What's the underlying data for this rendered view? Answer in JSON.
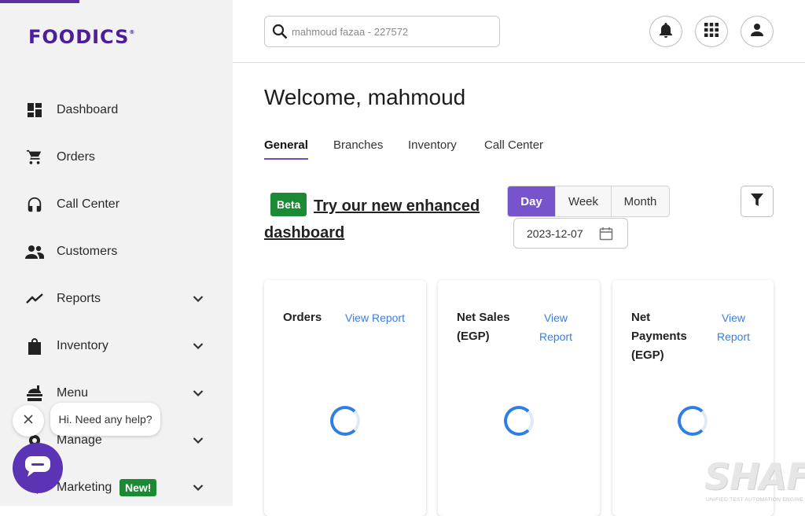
{
  "brand": {
    "logo_text": "FOODICS",
    "logo_mark": "®",
    "accent_color": "#5b33b5"
  },
  "sidebar": {
    "items": [
      {
        "label": "Dashboard",
        "icon": "dashboard-icon",
        "has_chevron": false
      },
      {
        "label": "Orders",
        "icon": "cart-icon",
        "has_chevron": false
      },
      {
        "label": "Call Center",
        "icon": "headset-icon",
        "has_chevron": false
      },
      {
        "label": "Customers",
        "icon": "people-icon",
        "has_chevron": false
      },
      {
        "label": "Reports",
        "icon": "trending-icon",
        "has_chevron": true
      },
      {
        "label": "Inventory",
        "icon": "bag-icon",
        "has_chevron": true
      },
      {
        "label": "Menu",
        "icon": "menu-food-icon",
        "has_chevron": true
      },
      {
        "label": "Manage",
        "icon": "gear-icon",
        "has_chevron": true
      },
      {
        "label": "Marketing",
        "icon": "megaphone-icon",
        "has_chevron": true,
        "badge": "New!"
      }
    ]
  },
  "header": {
    "search": {
      "value": "mahmoud fazaa - 227572",
      "icon": "search-icon"
    },
    "buttons": [
      {
        "name": "notifications",
        "icon": "bell-icon"
      },
      {
        "name": "apps",
        "icon": "apps-grid-icon"
      },
      {
        "name": "account",
        "icon": "person-icon"
      }
    ]
  },
  "main": {
    "welcome": "Welcome, mahmoud",
    "tabs": [
      {
        "label": "General",
        "active": true
      },
      {
        "label": "Branches",
        "active": false
      },
      {
        "label": "Inventory",
        "active": false
      },
      {
        "label": "Call Center",
        "active": false
      }
    ],
    "promo": {
      "badge": "Beta",
      "link_text": "Try our new enhanced dashboard"
    },
    "period": {
      "options": [
        "Day",
        "Week",
        "Month"
      ],
      "selected": "Day"
    },
    "date": "2023-12-07",
    "cards": [
      {
        "title": "Orders",
        "link": "View Report",
        "loading": true
      },
      {
        "title": "Net Sales (EGP)",
        "link": "View Report",
        "loading": true
      },
      {
        "title": "Net Payments (EGP)",
        "link": "View Report",
        "loading": true
      }
    ]
  },
  "chat": {
    "message": "Hi. Need any help?"
  },
  "watermark": {
    "title": "SHAFT",
    "subtitle": "UNIFIED TEST AUTOMATION ENGINE"
  }
}
